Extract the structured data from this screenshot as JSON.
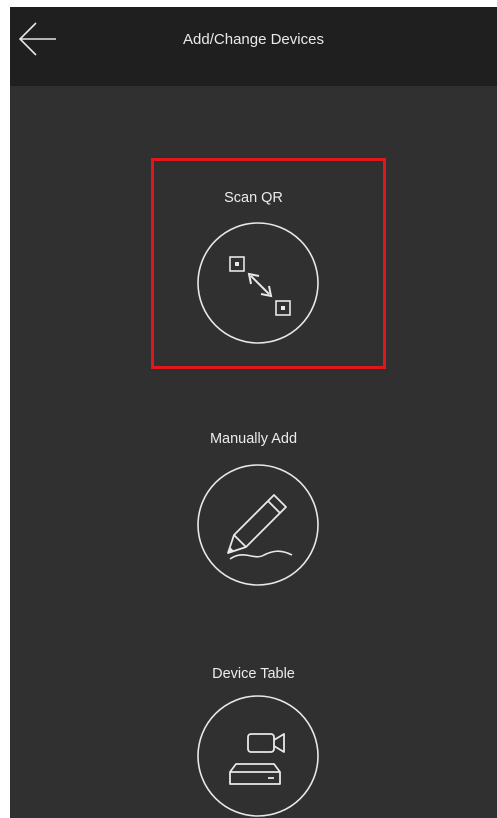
{
  "header": {
    "title": "Add/Change Devices",
    "back_icon": "arrow-left-icon"
  },
  "options": [
    {
      "label": "Scan QR",
      "icon": "scan-qr-icon",
      "highlighted": true
    },
    {
      "label": "Manually Add",
      "icon": "pencil-icon",
      "highlighted": false
    },
    {
      "label": "Device Table",
      "icon": "device-table-icon",
      "highlighted": false
    }
  ],
  "colors": {
    "background": "#303030",
    "header": "#1f1f1f",
    "text": "#ececec",
    "highlight": "#e0171d"
  }
}
